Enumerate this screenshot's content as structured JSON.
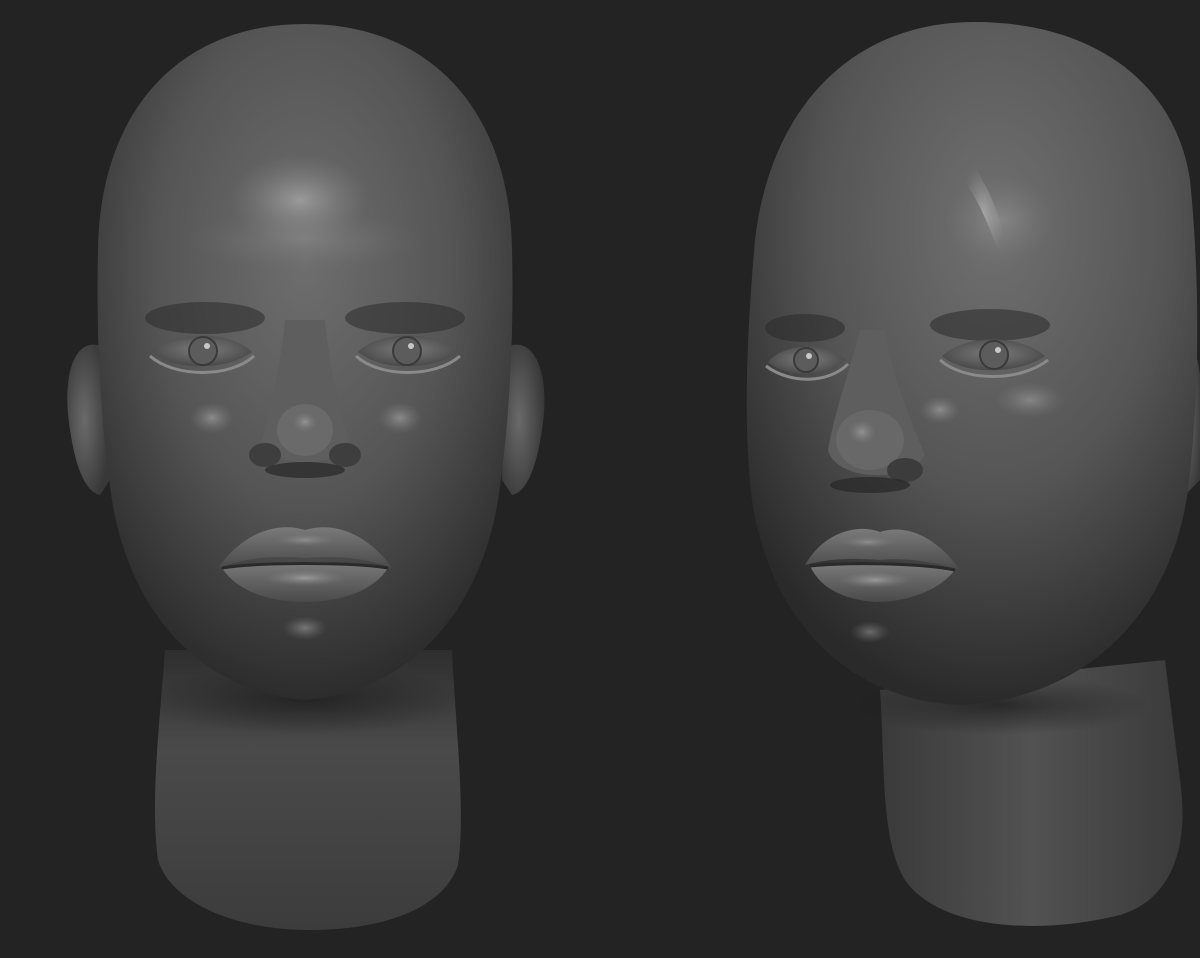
{
  "scene": {
    "background_color": "#232323",
    "material_color": "#5a5a5a",
    "subjects": [
      {
        "id": "head-front",
        "view": "front",
        "icon": "sculpt-head-front"
      },
      {
        "id": "head-three-quarter",
        "view": "three-quarter",
        "icon": "sculpt-head-three-quarter"
      }
    ]
  }
}
